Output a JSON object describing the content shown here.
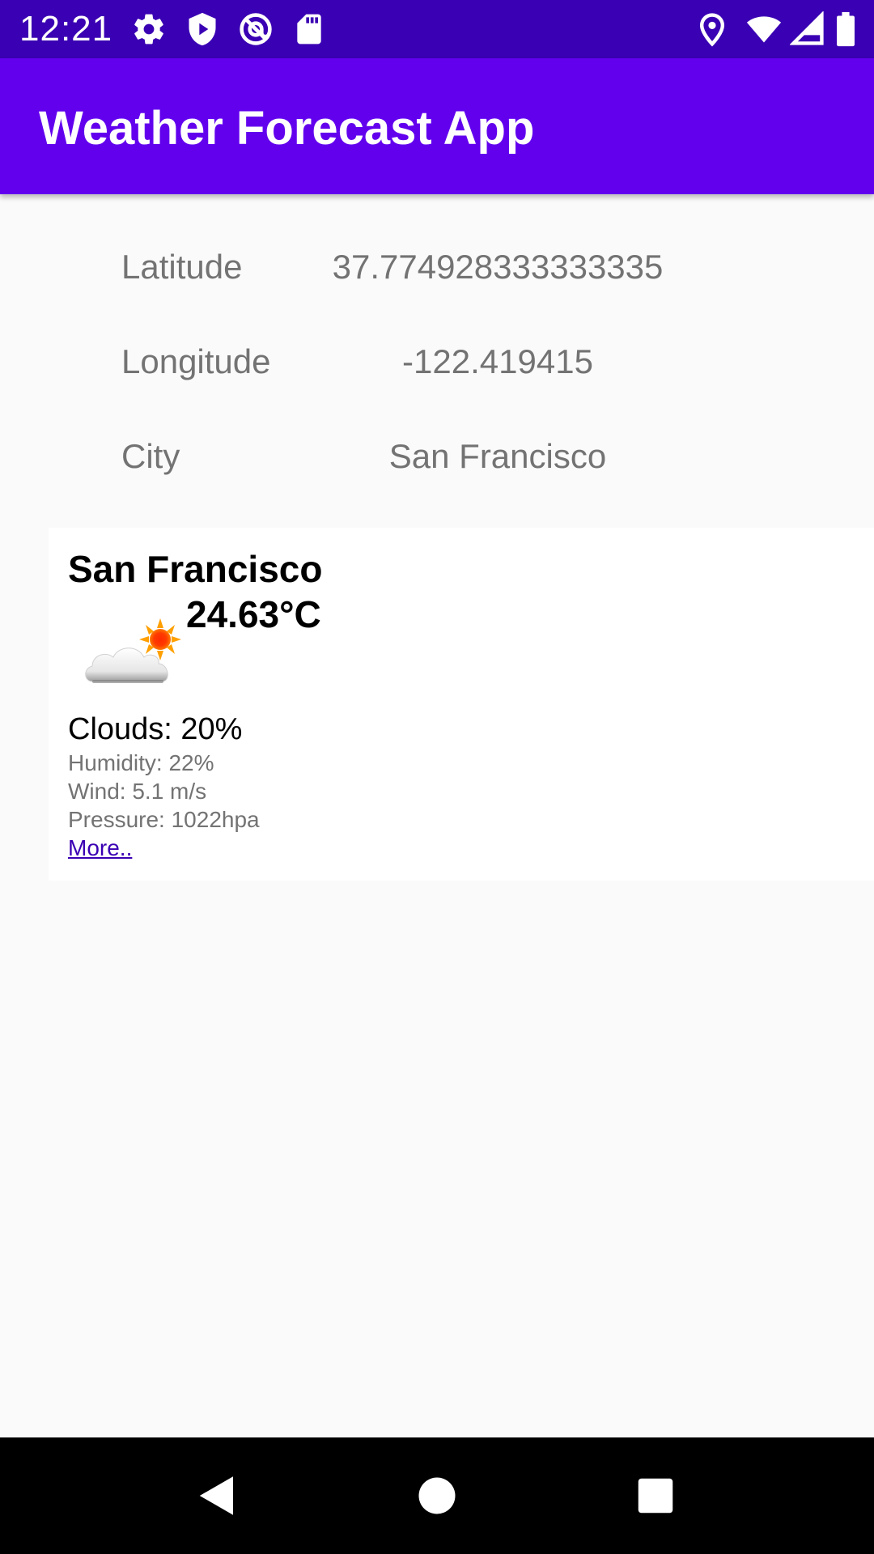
{
  "status_bar": {
    "time": "12:21",
    "icons_left": [
      "gear-icon",
      "shield-icon",
      "at-sign-icon",
      "sd-card-icon"
    ],
    "icons_right": [
      "location-icon",
      "wifi-icon",
      "signal-icon",
      "battery-icon"
    ],
    "background": "#3a00b3"
  },
  "app_bar": {
    "title": "Weather Forecast App",
    "background": "#6200ee"
  },
  "location": {
    "latitude_label": "Latitude",
    "latitude_value": "37.774928333333335",
    "longitude_label": "Longitude",
    "longitude_value": "-122.419415",
    "city_label": "City",
    "city_value": "San Francisco"
  },
  "weather_card": {
    "city": "San Francisco",
    "icon": "partly-cloudy-icon",
    "temperature": "24.63°C",
    "clouds": "Clouds: 20%",
    "humidity": "Humidity: 22%",
    "wind": "Wind: 5.1 m/s",
    "pressure": "Pressure: 1022hpa",
    "more_link": "More.."
  },
  "nav_bar": {
    "buttons": [
      "back-icon",
      "home-icon",
      "recents-icon"
    ]
  }
}
